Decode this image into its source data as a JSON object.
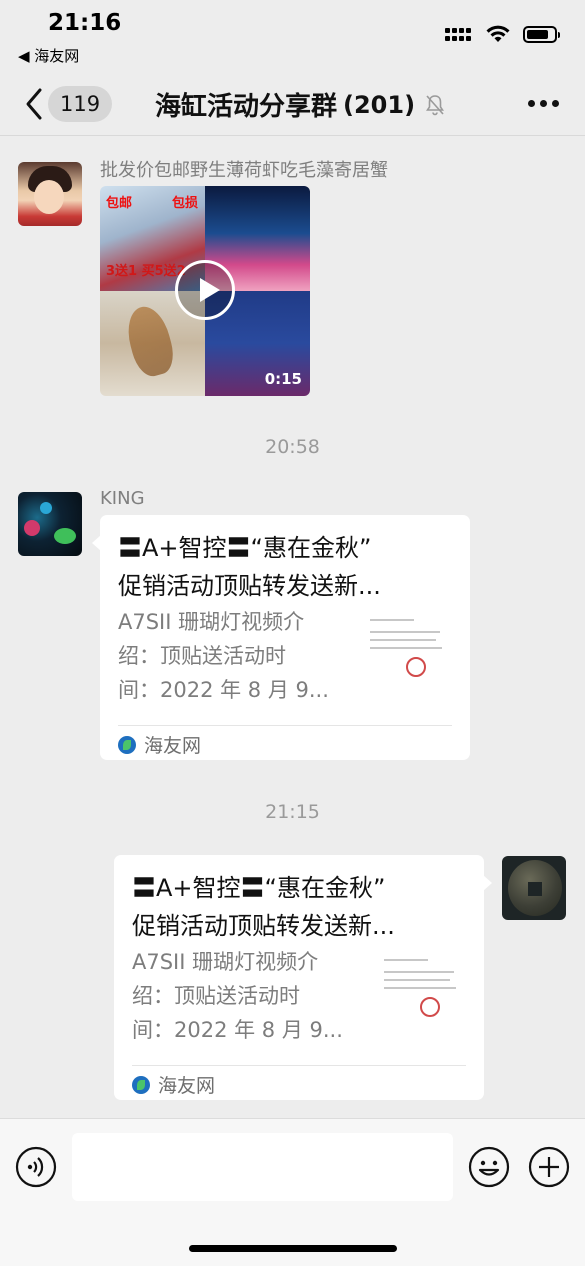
{
  "status_bar": {
    "time": "21:16",
    "back_app": "◀ 海友网",
    "battery_level": 0.8
  },
  "nav": {
    "back_badge": "119",
    "title": "海缸活动分享群",
    "member_count": "(201)",
    "icons": [
      "back-chevron-icon",
      "mute-bell-icon",
      "more-icon"
    ]
  },
  "messages": [
    {
      "type": "video",
      "sender": "批发价包邮野生薄荷虾吃毛藻寄居蟹",
      "thumb_labels": [
        "包邮",
        "包损",
        "3送1 买5送2"
      ],
      "duration": "0:15"
    },
    {
      "type": "timestamp",
      "text": "20:58"
    },
    {
      "type": "link",
      "sender": "KING",
      "title_line1": "〓A+智控〓“惠在金秋”",
      "title_line2": "促销活动顶贴转发送新...",
      "desc_line1": "A7SII 珊瑚灯视频介",
      "desc_line2": "绍：顶贴送活动时",
      "desc_line3": "间：2022 年 8 月 9...",
      "source": "海友网"
    },
    {
      "type": "timestamp",
      "text": "21:15"
    },
    {
      "type": "link",
      "sender": "",
      "title_line1": "〓A+智控〓“惠在金秋”",
      "title_line2": "促销活动顶贴转发送新...",
      "desc_line1": "A7SII 珊瑚灯视频介",
      "desc_line2": "绍：顶贴送活动时",
      "desc_line3": "间：2022 年 8 月 9...",
      "source": "海友网"
    }
  ],
  "input_bar": {
    "placeholder": "",
    "icons": [
      "voice-icon",
      "emoji-icon",
      "plus-icon"
    ]
  },
  "colors": {
    "background": "#ededed",
    "bubble": "#ffffff",
    "muted_text": "#7f7f7f",
    "source_icon": "#1e6fbf"
  }
}
